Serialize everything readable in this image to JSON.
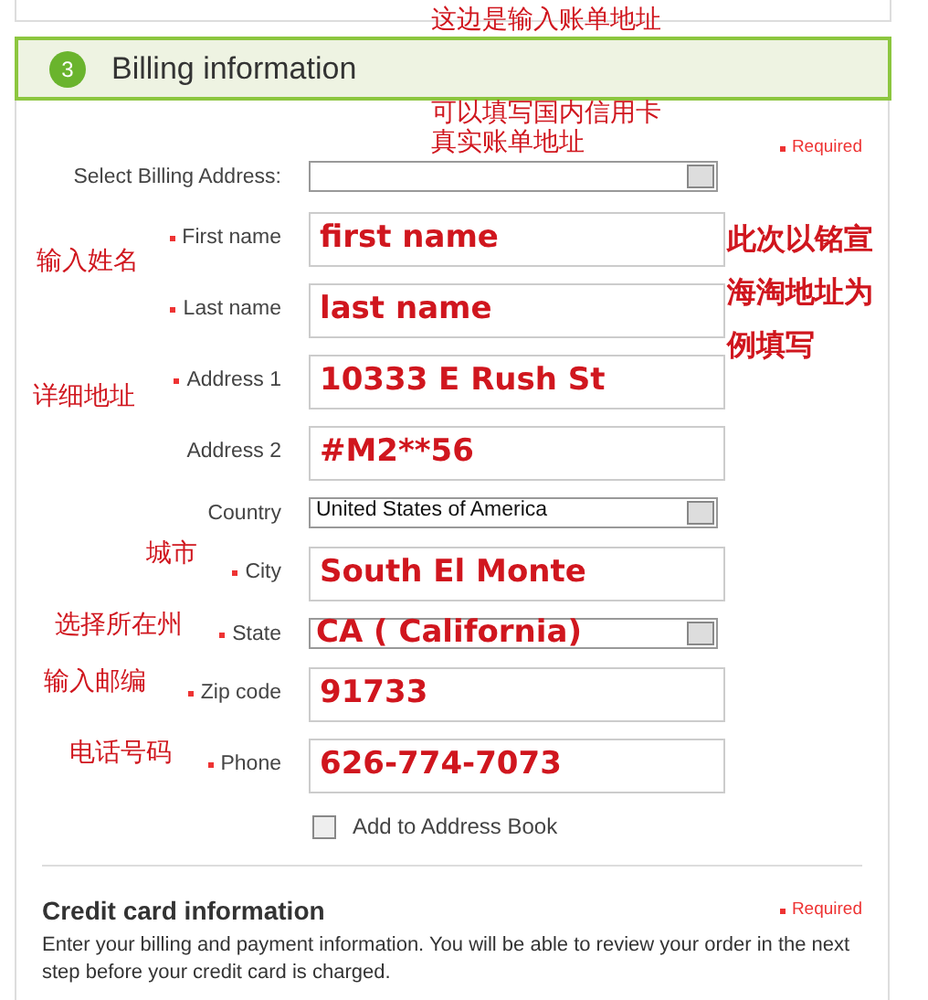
{
  "header": {
    "step": "3",
    "title": "Billing information"
  },
  "required_note": "Required",
  "fields": [
    {
      "kind": "select",
      "label": "Select Billing Address:",
      "required": false
    },
    {
      "kind": "text",
      "label": "First name",
      "required": true,
      "value": "first name"
    },
    {
      "kind": "text",
      "label": "Last name",
      "required": true,
      "value": "last name"
    },
    {
      "kind": "text",
      "label": "Address 1",
      "required": true,
      "value": "10333 E Rush St"
    },
    {
      "kind": "text",
      "label": "Address 2",
      "required": false,
      "value": "#M2**56"
    },
    {
      "kind": "select",
      "label": "Country",
      "required": false,
      "value": "United States of America"
    },
    {
      "kind": "text",
      "label": "City",
      "required": true,
      "value": "South El Monte"
    },
    {
      "kind": "annotated-select",
      "label": "State",
      "required": true,
      "value": "CA ( California)"
    },
    {
      "kind": "text",
      "label": "Zip code",
      "required": true,
      "value": "91733"
    },
    {
      "kind": "text",
      "label": "Phone",
      "required": true,
      "value": "626-774-7073"
    }
  ],
  "address_book": {
    "label": "Add to Address Book",
    "checked": false
  },
  "credit_card": {
    "title": "Credit card information",
    "required_note": "Required",
    "text": "Enter your billing and payment information. You will be able to review your order in the next step before your credit card is charged."
  },
  "annotations": [
    {
      "text": "这边是输入账单地址",
      "bold": false
    },
    {
      "text": "可以填写国内信用卡",
      "bold": false
    },
    {
      "text": "真实账单地址",
      "bold": false
    },
    {
      "text": "输入姓名",
      "bold": false
    },
    {
      "text": "此次以铭宣海淘地址为例填写",
      "bold": true
    },
    {
      "text": "详细地址",
      "bold": false
    },
    {
      "text": "城市",
      "bold": false
    },
    {
      "text": "选择所在州",
      "bold": false
    },
    {
      "text": "输入邮编",
      "bold": false
    },
    {
      "text": "电话号码",
      "bold": false
    }
  ]
}
